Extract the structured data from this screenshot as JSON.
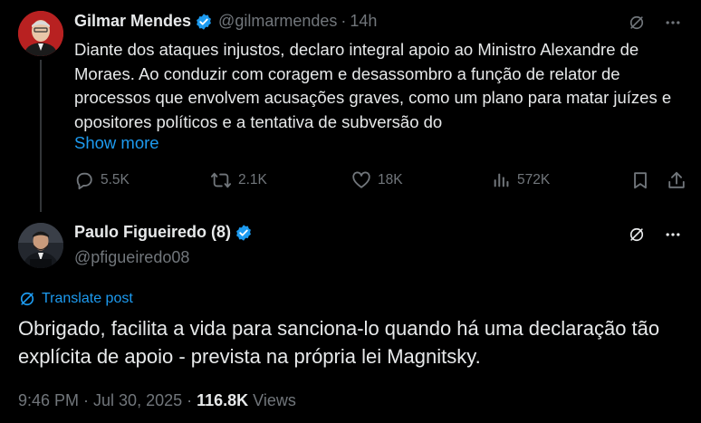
{
  "tweet1": {
    "name": "Gilmar Mendes",
    "handle": "@gilmarmendes",
    "separator": "·",
    "time": "14h",
    "text": "Diante dos ataques injustos, declaro integral apoio ao Ministro Alexandre de Moraes. Ao conduzir com coragem e desassombro a função de relator de processos que envolvem acusações graves, como um plano para matar juízes e opositores políticos e a tentativa de subversão do",
    "show_more": "Show more",
    "actions": {
      "replies": "5.5K",
      "reposts": "2.1K",
      "likes": "18K",
      "views": "572K"
    }
  },
  "tweet2": {
    "name": "Paulo Figueiredo (8)",
    "handle": "@pfigueiredo08",
    "translate_label": "Translate post",
    "text": "Obrigado, facilita a vida para sanciona-lo quando há uma declaração tão explícita de apoio - prevista na própria lei Magnitsky.",
    "timestamp": "9:46 PM · Jul 30, 2025",
    "meta_separator": " · ",
    "views_count": "116.8K",
    "views_label": " Views"
  },
  "colors": {
    "background": "#000000",
    "text": "#e7e9ea",
    "muted": "#71767b",
    "accent": "#1d9bf0",
    "verified": "#1d9bf0"
  },
  "icons": [
    "grok-icon",
    "more-icon",
    "reply-icon",
    "repost-icon",
    "like-icon",
    "views-icon",
    "bookmark-icon",
    "share-icon",
    "verified-badge-icon",
    "translate-icon"
  ]
}
